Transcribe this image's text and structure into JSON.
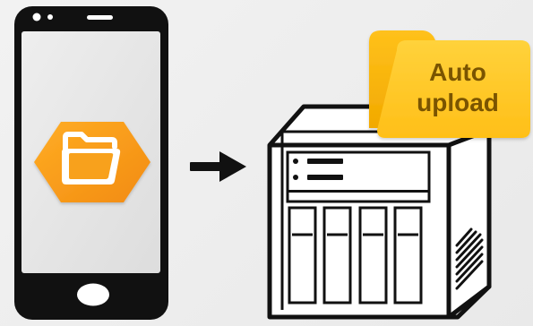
{
  "badge": {
    "line1": "Auto",
    "line2": "upload"
  },
  "colors": {
    "background": "#efefef",
    "device_frame": "#101010",
    "app_icon_orange": "#f29a1a",
    "app_icon_center": "#ffb51f",
    "folder_back": "#f6b400",
    "folder_front": "#ffc928",
    "folder_text": "#7a5400",
    "nas_outline": "#111111",
    "nas_fill": "#ffffff"
  },
  "icons": {
    "phone": "smartphone-icon",
    "folder_app": "folder-app-icon",
    "arrow": "right-arrow-icon",
    "nas": "nas-drive-icon",
    "badge_folder": "auto-upload-folder-icon"
  }
}
